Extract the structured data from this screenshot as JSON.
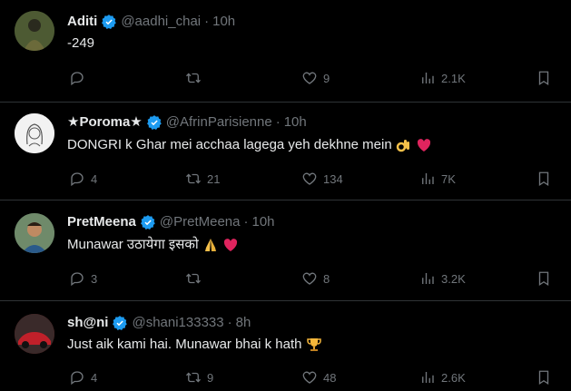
{
  "tweets": [
    {
      "name": "Aditi",
      "handle": "@aadhi_chai",
      "time": "10h",
      "text": "-249",
      "replies": "",
      "retweets": "",
      "likes": "9",
      "views": "2.1K",
      "avatar_color": "#3b4a2a"
    },
    {
      "name": "★Poroma★",
      "handle": "@AfrinParisienne",
      "time": "10h",
      "text": "DONGRI k Ghar mei acchaa lagega yeh dekhne mein",
      "replies": "4",
      "retweets": "21",
      "likes": "134",
      "views": "7K",
      "avatar_color": "#d8d8d8"
    },
    {
      "name": "PretMeena",
      "handle": "@PretMeena",
      "time": "10h",
      "text": "Munawar उठायेगा इसको",
      "replies": "3",
      "retweets": "",
      "likes": "8",
      "views": "3.2K",
      "avatar_color": "#5c7a6a"
    },
    {
      "name": "sh@ni",
      "handle": "@shani133333",
      "time": "8h",
      "text": "Just aik kami hai. Munawar bhai k hath",
      "replies": "4",
      "retweets": "9",
      "likes": "48",
      "views": "2.6K",
      "avatar_color": "#7a1a1a"
    }
  ],
  "separator": "·",
  "colors": {
    "background": "#000000",
    "text": "#e7e9ea",
    "muted": "#71767b",
    "verified": "#1d9bf0",
    "border": "#2f3336"
  }
}
